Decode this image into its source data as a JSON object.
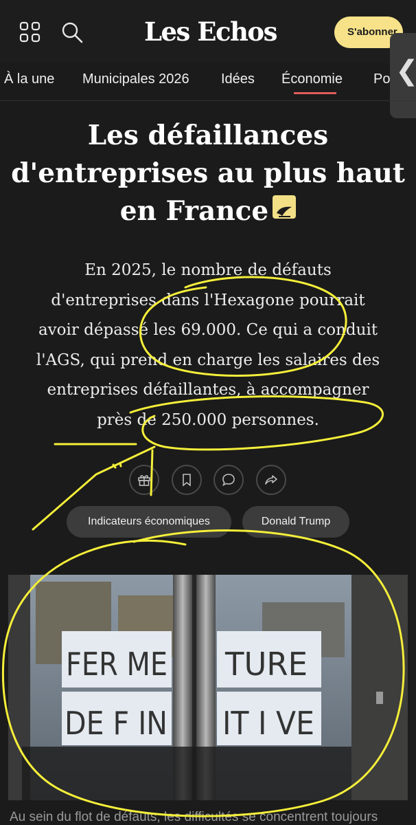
{
  "header": {
    "logo": "Les Echos",
    "subscribe_label": "S'abonner",
    "side_tab_glyph": "❮"
  },
  "nav": {
    "items": [
      "À la une",
      "Municipales 2026",
      "Idées",
      "Économie",
      "Po"
    ],
    "active_index": 3
  },
  "article": {
    "headline_lines": [
      "Les défaillances",
      "d'entreprises au plus haut",
      "en France"
    ],
    "lead_lines": [
      "En 2025, le nombre de défauts",
      "d'entreprises dans l'Hexagone pourrait",
      "avoir dépassé les 69.000. Ce qui a conduit",
      "l'AGS, qui prend en charge les salaires des",
      "entreprises défaillantes, à accompagner",
      "près de 250.000 personnes."
    ],
    "actions": [
      "gift-icon",
      "bookmark-icon",
      "comment-icon",
      "share-icon"
    ],
    "tags": [
      "Indicateurs économiques",
      "Donald Trump"
    ],
    "photo_sign_words": [
      "FER ME",
      "TURE",
      "DE F IN",
      "IT I VE"
    ],
    "caption": "Au sein du flot de défauts, les difficultés se concentrent toujours"
  },
  "colors": {
    "background": "#1b1b1b",
    "accent_yellow": "#f7e28a",
    "nav_underline": "#e05c5c",
    "annotation": "#f5ef3a"
  }
}
